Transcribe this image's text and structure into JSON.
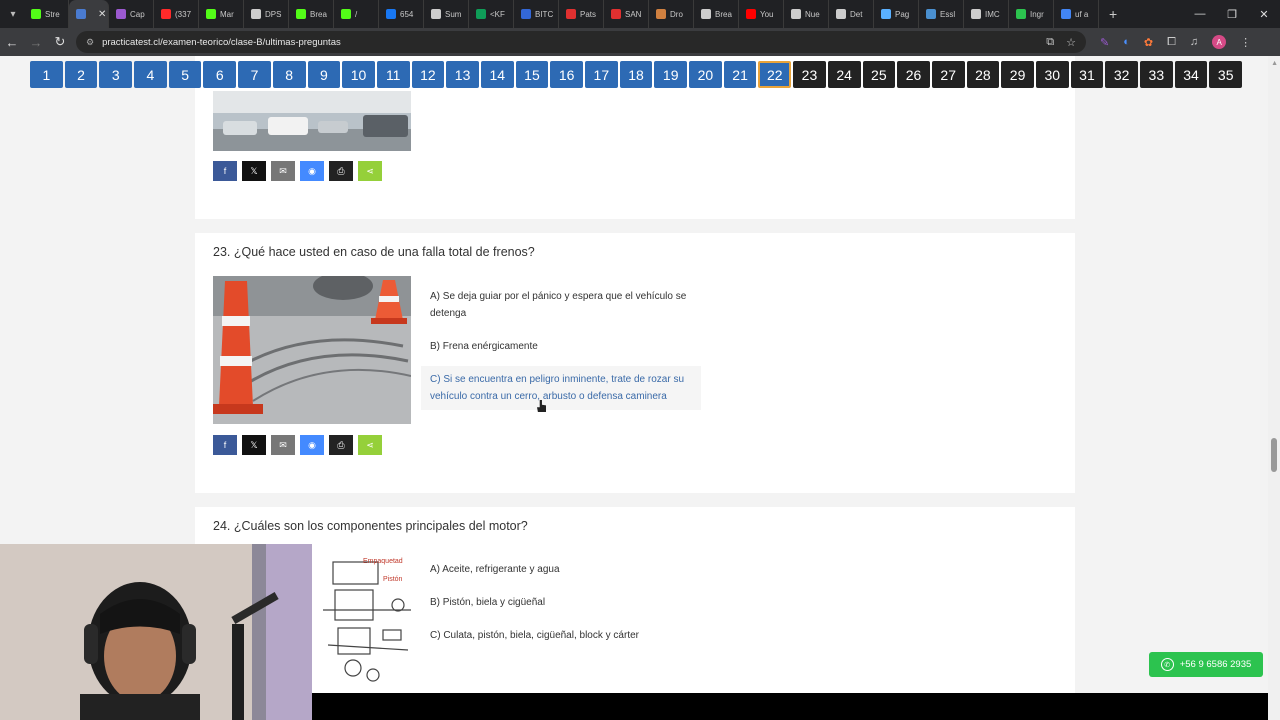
{
  "browser": {
    "tabs": [
      {
        "label": "Stre",
        "color": "#53fc18"
      },
      {
        "label": "",
        "color": "#4a7bd0",
        "active": true
      },
      {
        "label": "Cap",
        "color": "#9b59d0"
      },
      {
        "label": "(337",
        "color": "#ff2a2a"
      },
      {
        "label": "Mar",
        "color": "#53fc18"
      },
      {
        "label": "DPS",
        "color": "#cccccc"
      },
      {
        "label": "Brea",
        "color": "#53fc18"
      },
      {
        "label": "/",
        "color": "#53fc18"
      },
      {
        "label": "654",
        "color": "#1877f2"
      },
      {
        "label": "Sum",
        "color": "#cccccc"
      },
      {
        "label": "<KF",
        "color": "#0f9d58"
      },
      {
        "label": "BITC",
        "color": "#3367d6"
      },
      {
        "label": "Pats",
        "color": "#e03030"
      },
      {
        "label": "SAN",
        "color": "#e03030"
      },
      {
        "label": "Dro",
        "color": "#d08040"
      },
      {
        "label": "Brea",
        "color": "#cccccc"
      },
      {
        "label": "You",
        "color": "#ff0000"
      },
      {
        "label": "Nue",
        "color": "#cccccc"
      },
      {
        "label": "Det",
        "color": "#cccccc"
      },
      {
        "label": "Pag",
        "color": "#5ab0ff"
      },
      {
        "label": "Essl",
        "color": "#4a90d0"
      },
      {
        "label": "IMC",
        "color": "#cccccc"
      },
      {
        "label": "Ingr",
        "color": "#2cc34f"
      },
      {
        "label": "uf a",
        "color": "#4285f4"
      }
    ],
    "url": "practicatest.cl/examen-teorico/clase-B/ultimas-preguntas"
  },
  "nav": {
    "numbers": [
      "1",
      "2",
      "3",
      "4",
      "5",
      "6",
      "7",
      "8",
      "9",
      "10",
      "11",
      "12",
      "13",
      "14",
      "15",
      "16",
      "17",
      "18",
      "19",
      "20",
      "21",
      "22",
      "23",
      "24",
      "25",
      "26",
      "27",
      "28",
      "29",
      "30",
      "31",
      "32",
      "33",
      "34",
      "35"
    ],
    "current": "22"
  },
  "q23": {
    "title": "23. ¿Qué hace usted en caso de una falla total de frenos?",
    "options": [
      "A) Se deja guiar por el pánico y espera que el vehículo se detenga",
      "B) Frena enérgicamente",
      "C) Si se encuentra en peligro inminente, trate de rozar su vehículo contra un cerro, arbusto o defensa caminera"
    ]
  },
  "q24": {
    "title": "24. ¿Cuáles son los componentes principales del motor?",
    "image_labels": [
      "Empaquetad",
      "Pistón"
    ],
    "options": [
      "A) Aceite, refrigerante y agua",
      "B) Pistón, biela y cigüeñal",
      "C) Culata, pistón, biela, cigüeñal, block y cárter"
    ]
  },
  "whatsapp": {
    "label": "+56 9 6586 2935"
  }
}
